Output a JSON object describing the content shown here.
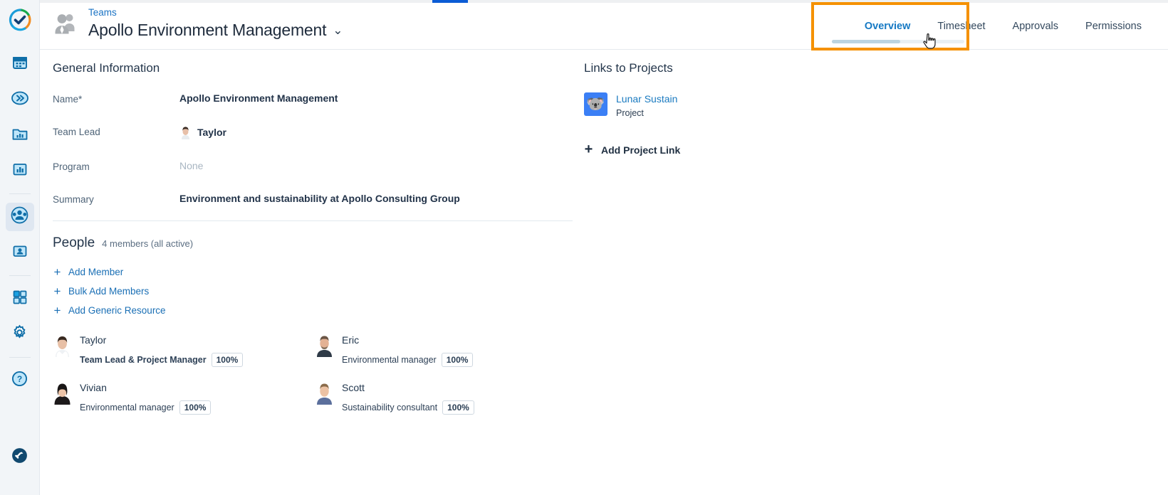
{
  "app": {
    "logo_icon": "checkmark-ring-logo"
  },
  "top_progress": {
    "visible": true,
    "accent": "#0b5cd5"
  },
  "sidebar": {
    "items": [
      {
        "icon": "calendar-icon",
        "name": "calendar",
        "active": false
      },
      {
        "icon": "double-chevron-right-icon",
        "name": "expand",
        "active": false
      },
      {
        "icon": "folder-chart-icon",
        "name": "portfolio",
        "active": false
      },
      {
        "icon": "bar-chart-icon",
        "name": "reports",
        "active": false
      },
      {
        "icon": "team-people-icon",
        "name": "teams",
        "active": true
      },
      {
        "icon": "person-card-icon",
        "name": "resources",
        "active": false
      },
      {
        "icon": "grid-apps-icon",
        "name": "apps",
        "active": false
      },
      {
        "icon": "gear-icon",
        "name": "settings",
        "active": false
      },
      {
        "icon": "question-circle-icon",
        "name": "help",
        "active": false
      },
      {
        "icon": "pin-circle-icon",
        "name": "pin",
        "active": false
      }
    ]
  },
  "header": {
    "breadcrumb": "Teams",
    "title": "Apollo Environment Management",
    "title_caret": "⌄",
    "team_icon": "team-avatar-icon",
    "tabs": [
      {
        "label": "Overview",
        "active": true
      },
      {
        "label": "Timesheet",
        "active": false
      },
      {
        "label": "Approvals",
        "active": false
      },
      {
        "label": "Permissions",
        "active": false
      }
    ],
    "highlight_color": "#f59100"
  },
  "general_information": {
    "section_title": "General Information",
    "fields": [
      {
        "label": "Name*",
        "value": "Apollo Environment Management",
        "type": "text"
      },
      {
        "label": "Team Lead",
        "value": "Taylor",
        "type": "person",
        "avatar": "avatar-taylor"
      },
      {
        "label": "Program",
        "value": "None",
        "type": "placeholder"
      },
      {
        "label": "Summary",
        "value": "Environment and sustainability at Apollo Consulting Group",
        "type": "text"
      }
    ]
  },
  "people": {
    "title": "People",
    "count_text": "4 members (all active)",
    "actions": [
      {
        "label": "Add Member",
        "icon": "plus-icon"
      },
      {
        "label": "Bulk Add Members",
        "icon": "plus-icon"
      },
      {
        "label": "Add Generic Resource",
        "icon": "plus-icon"
      }
    ],
    "members": [
      {
        "name": "Taylor",
        "role": "Team Lead & Project Manager",
        "allocation": "100%",
        "avatar": "avatar-taylor",
        "is_lead": true
      },
      {
        "name": "Eric",
        "role": "Environmental manager",
        "allocation": "100%",
        "avatar": "avatar-eric",
        "is_lead": false
      },
      {
        "name": "Vivian",
        "role": "Environmental manager",
        "allocation": "100%",
        "avatar": "avatar-vivian",
        "is_lead": false
      },
      {
        "name": "Scott",
        "role": "Sustainability consultant",
        "allocation": "100%",
        "avatar": "avatar-scott",
        "is_lead": false
      }
    ]
  },
  "links_to_projects": {
    "section_title": "Links to Projects",
    "projects": [
      {
        "name": "Lunar Sustain",
        "type": "Project",
        "icon_glyph": "🐨",
        "icon_bg": "#3b7ff5"
      }
    ],
    "add_label": "Add Project Link",
    "add_icon": "plus-icon"
  }
}
